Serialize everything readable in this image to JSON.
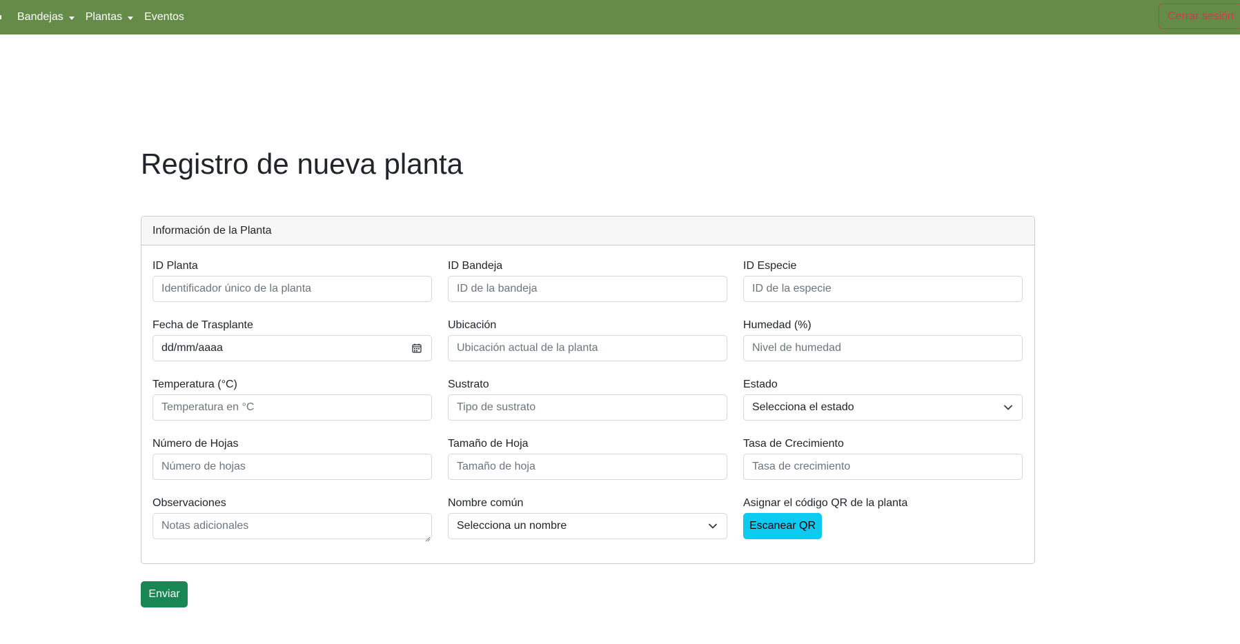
{
  "navbar": {
    "items": [
      {
        "label": "Bandejas",
        "dropdown": true
      },
      {
        "label": "Plantas",
        "dropdown": true
      },
      {
        "label": "Eventos",
        "dropdown": false
      }
    ],
    "logout_label": "Cerrar sesión",
    "bg_color": "#648c48"
  },
  "page": {
    "title": "Registro de nueva planta"
  },
  "card": {
    "header": "Información de la Planta",
    "fields": {
      "id_planta": {
        "label": "ID Planta",
        "placeholder": "Identificador único de la planta"
      },
      "id_bandeja": {
        "label": "ID Bandeja",
        "placeholder": "ID de la bandeja"
      },
      "id_especie": {
        "label": "ID Especie",
        "placeholder": "ID de la especie"
      },
      "fecha": {
        "label": "Fecha de Trasplante",
        "value": "dd/mm/aaaa",
        "icon": "calendar-icon"
      },
      "ubicacion": {
        "label": "Ubicación",
        "placeholder": "Ubicación actual de la planta"
      },
      "humedad": {
        "label": "Humedad (%)",
        "placeholder": "Nivel de humedad"
      },
      "temperatura": {
        "label": "Temperatura (°C)",
        "placeholder": "Temperatura en °C"
      },
      "sustrato": {
        "label": "Sustrato",
        "placeholder": "Tipo de sustrato"
      },
      "estado": {
        "label": "Estado",
        "selected": "Selecciona el estado"
      },
      "num_hojas": {
        "label": "Número de Hojas",
        "placeholder": "Número de hojas"
      },
      "tamano_hoja": {
        "label": "Tamaño de Hoja",
        "placeholder": "Tamaño de hoja"
      },
      "tasa": {
        "label": "Tasa de Crecimiento",
        "placeholder": "Tasa de crecimiento"
      },
      "observaciones": {
        "label": "Observaciones",
        "placeholder": "Notas adicionales"
      },
      "nombre_comun": {
        "label": "Nombre común",
        "selected": "Selecciona un nombre"
      },
      "qr": {
        "label": "Asignar el código QR de la planta",
        "button": "Escanear QR"
      }
    }
  },
  "submit_label": "Enviar",
  "colors": {
    "submit": "#198754",
    "qr_button": "#0dcaf0",
    "logout": "#dc3545"
  }
}
